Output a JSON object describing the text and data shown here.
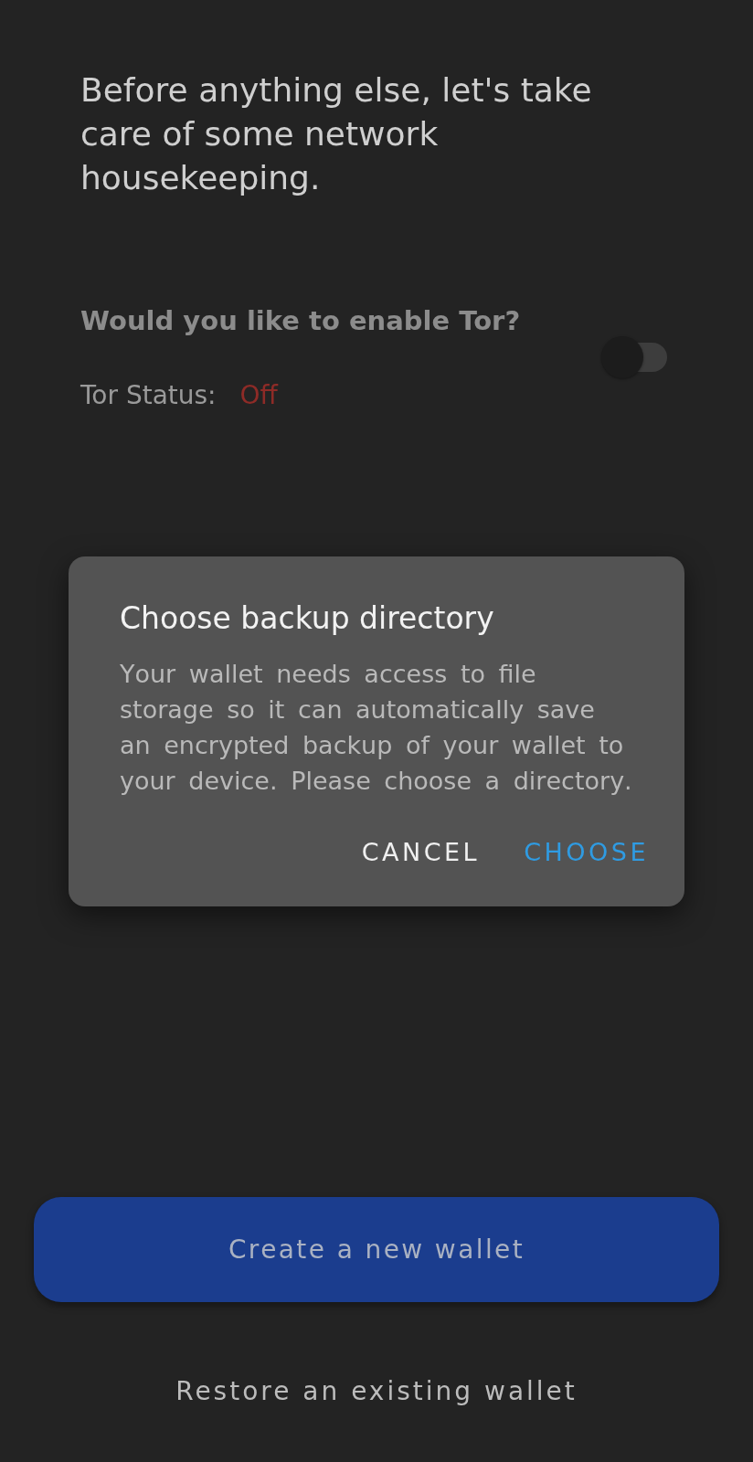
{
  "intro": {
    "text": "Before anything else, let's take care of some network housekeeping."
  },
  "tor": {
    "question": "Would you like to enable Tor?",
    "on": false,
    "status_label": "Tor Status:",
    "status_value": "Off"
  },
  "dialog": {
    "title": "Choose backup directory",
    "message": "Your wallet needs access to file storage so it can automatically save an encrypted backup of your wallet to your device. Please choose a directory.",
    "buttons": [
      {
        "label": "CANCEL",
        "kind": "dismiss"
      },
      {
        "label": "CHOOSE",
        "kind": "confirm"
      }
    ]
  },
  "actions": [
    {
      "label": "Create a new wallet",
      "kind": "primary"
    },
    {
      "label": "Restore an existing wallet",
      "kind": "text"
    }
  ]
}
